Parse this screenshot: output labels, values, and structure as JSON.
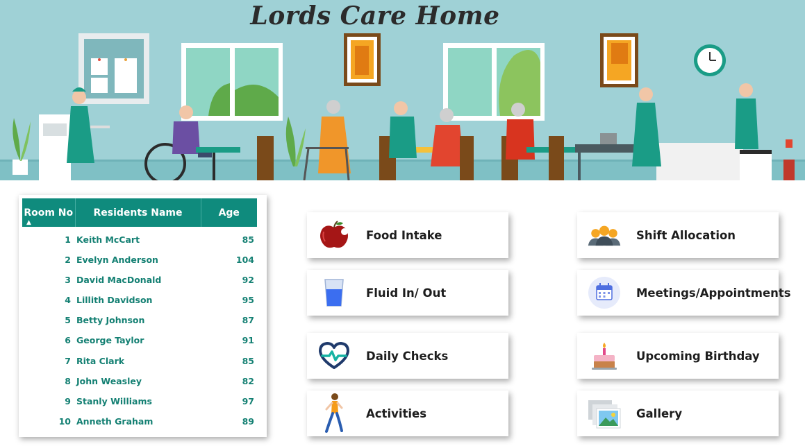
{
  "banner": {
    "title": "Lords Care Home"
  },
  "residents_table": {
    "columns": {
      "room": "Room No",
      "name": "Residents Name",
      "age": "Age"
    },
    "rows": [
      {
        "room": "1",
        "name": "Keith McCart",
        "age": "85"
      },
      {
        "room": "2",
        "name": "Evelyn Anderson",
        "age": "104"
      },
      {
        "room": "3",
        "name": "David MacDonald",
        "age": "92"
      },
      {
        "room": "4",
        "name": "Lillith Davidson",
        "age": "95"
      },
      {
        "room": "5",
        "name": "Betty Johnson",
        "age": "87"
      },
      {
        "room": "6",
        "name": "George Taylor",
        "age": "91"
      },
      {
        "room": "7",
        "name": "Rita Clark",
        "age": "85"
      },
      {
        "room": "8",
        "name": "John Weasley",
        "age": "82"
      },
      {
        "room": "9",
        "name": "Stanly Williams",
        "age": "97"
      },
      {
        "room": "10",
        "name": "Anneth Graham",
        "age": "89"
      }
    ]
  },
  "nav": {
    "food_intake": {
      "label": "Food Intake",
      "icon": "apple-icon"
    },
    "fluid": {
      "label": "Fluid In/ Out",
      "icon": "water-glass-icon"
    },
    "daily_checks": {
      "label": "Daily Checks",
      "icon": "heartbeat-icon"
    },
    "activities": {
      "label": "Activities",
      "icon": "running-person-icon"
    },
    "shift_allocation": {
      "label": "Shift Allocation",
      "icon": "staff-group-icon"
    },
    "meetings": {
      "label": "Meetings/Appointments",
      "icon": "calendar-icon"
    },
    "birthday": {
      "label": "Upcoming Birthday",
      "icon": "birthday-cake-icon"
    },
    "gallery": {
      "label": "Gallery",
      "icon": "gallery-icon"
    }
  },
  "colors": {
    "accent": "#0f8b7d",
    "banner_bg": "#9fd1d6",
    "table_text": "#148073"
  }
}
